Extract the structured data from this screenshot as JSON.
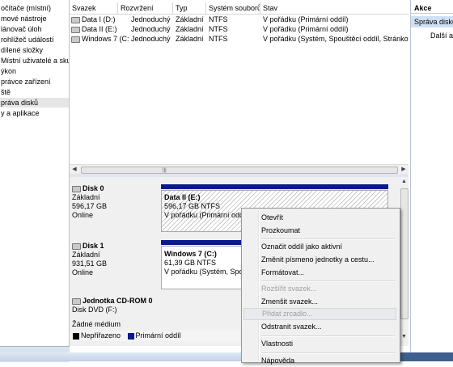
{
  "tree": {
    "items": [
      "očítače (místní)",
      "mové nástroje",
      "lánovač úloh",
      "rohlížeč událostí",
      "dílené složky",
      "Místní uživatelé a skupi",
      "ýkon",
      "právce zařízení",
      "ště",
      "práva disků",
      "y a aplikace"
    ],
    "selected_index": 9
  },
  "volumes": {
    "columns": [
      "Svazek",
      "Rozvržení",
      "Typ",
      "Systém souborů",
      "Stav"
    ],
    "rows": [
      [
        "Data I (D:)",
        "Jednoduchý",
        "Základní",
        "NTFS",
        "V pořádku (Primární oddíl)"
      ],
      [
        "Data II (E:)",
        "Jednoduchý",
        "Základní",
        "NTFS",
        "V pořádku (Primární oddíl)"
      ],
      [
        "Windows 7 (C:)",
        "Jednoduchý",
        "Základní",
        "NTFS",
        "V pořádku (Systém, Spouštěcí oddíl, Stránkovací"
      ]
    ]
  },
  "disks": [
    {
      "name": "Disk 0",
      "type": "Základní",
      "size": "596,17 GB",
      "status": "Online",
      "partition": {
        "title": "Data II  (E:)",
        "size": "596,17 GB NTFS",
        "status": "V pořádku (Primární oddíl"
      }
    },
    {
      "name": "Disk 1",
      "type": "Základní",
      "size": "931,51 GB",
      "status": "Online",
      "partition": {
        "title": "Windows 7  (C:)",
        "size": "61,39 GB NTFS",
        "status": "V pořádku (Systém, Spouš"
      }
    },
    {
      "name": "Jednotka CD-ROM 0",
      "type": "Disk DVD (F:)",
      "status": "Žádné médium"
    }
  ],
  "legend": {
    "unallocated": "Nepřiřazeno",
    "primary": "Primární oddíl",
    "unallocated_color": "#000000",
    "primary_color": "#0a1a8c"
  },
  "actions": {
    "header": "Akce",
    "disk_mgmt": "Správa disků",
    "more": "Další akce"
  },
  "context_menu": {
    "items": [
      {
        "label": "Otevřít",
        "disabled": false
      },
      {
        "label": "Prozkoumat",
        "disabled": false
      },
      {
        "sep": true
      },
      {
        "label": "Označit oddíl jako aktivní",
        "disabled": false
      },
      {
        "label": "Změnit písmeno jednotky a cestu...",
        "disabled": false
      },
      {
        "label": "Formátovat...",
        "disabled": false
      },
      {
        "sep": true
      },
      {
        "label": "Rozšířit svazek...",
        "disabled": true
      },
      {
        "label": "Zmenšit svazek...",
        "disabled": false
      },
      {
        "label": "Přidat zrcadlo...",
        "disabled": true,
        "highlighted": true
      },
      {
        "label": "Odstranit svazek...",
        "disabled": false
      },
      {
        "sep": true
      },
      {
        "label": "Vlastnosti",
        "disabled": false
      },
      {
        "sep": true
      },
      {
        "label": "Nápověda",
        "disabled": false
      }
    ]
  }
}
